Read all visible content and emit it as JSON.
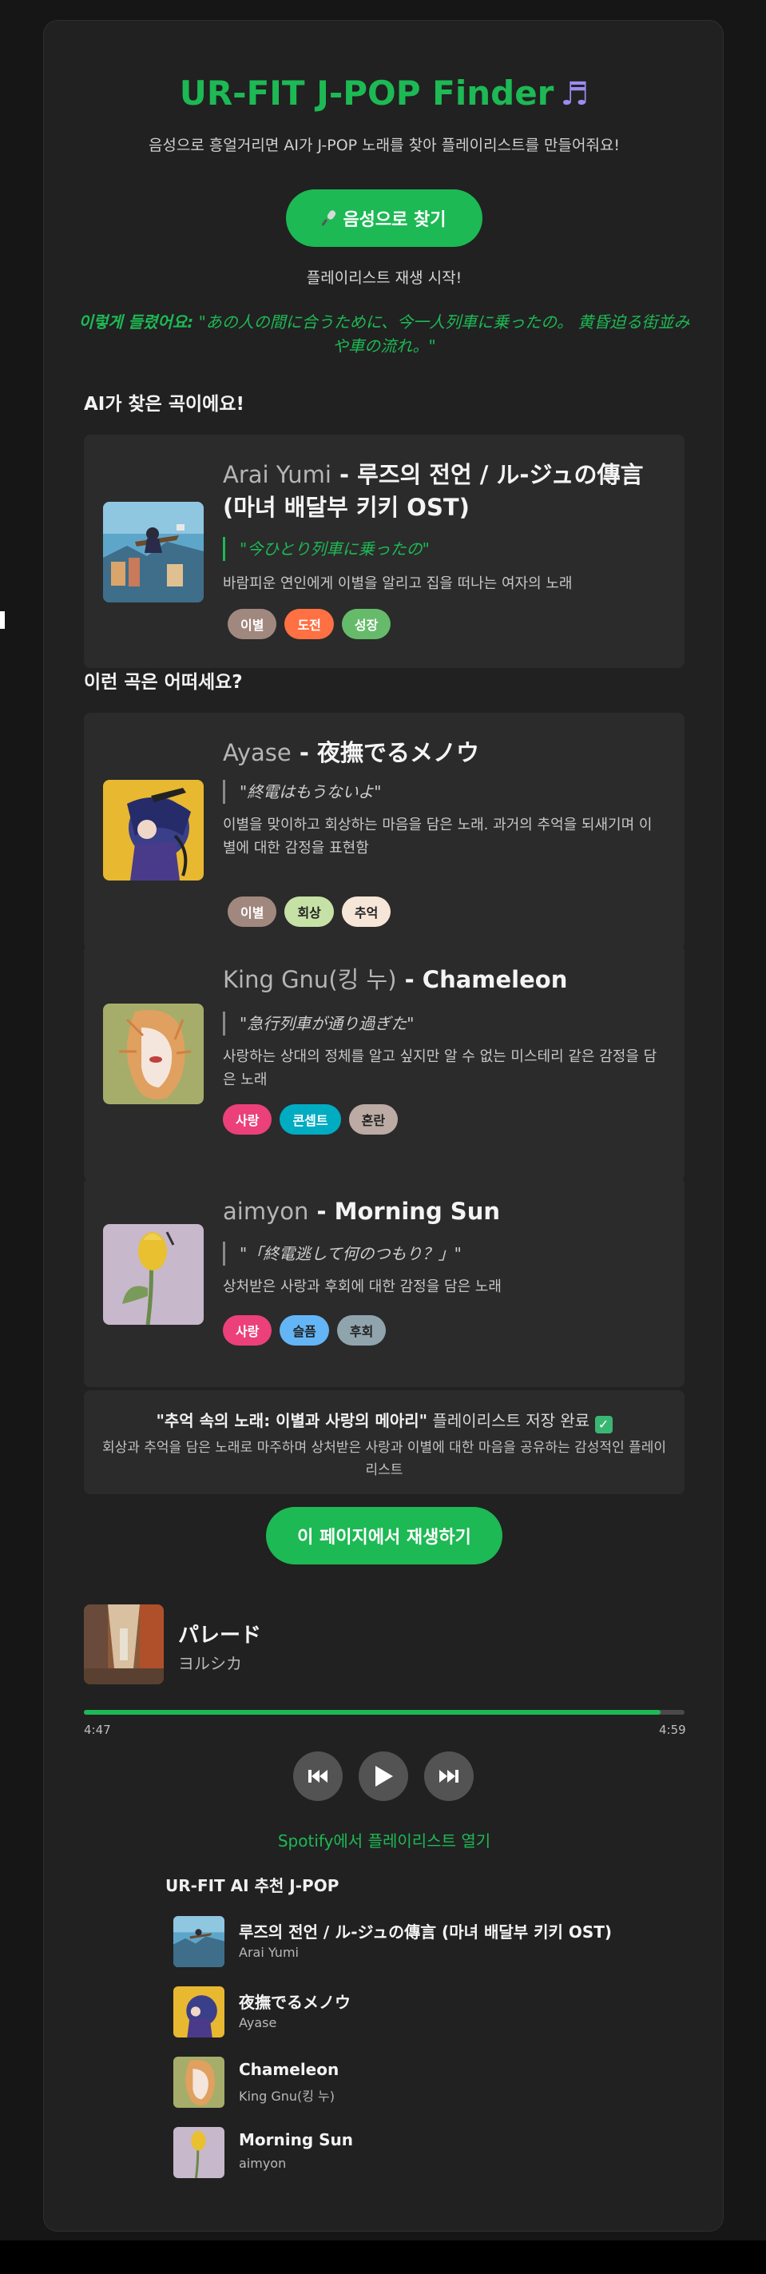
{
  "header": {
    "title": "UR-FIT J-POP Finder",
    "title_icon": "music-note-icon",
    "subtitle": "음성으로 흥얼거리면 AI가 J-POP 노래를 찾아 플레이리스트를 만들어줘요!",
    "voice_button_label": "음성으로 찾기",
    "voice_button_icon": "microphone-icon",
    "status_text": "플레이리스트 재생 시작!",
    "heard_label": "이렇게 들렸어요:",
    "heard_text": "\"あの人の間に合うために、今一人列車に乗ったの。 黄昏迫る街並みや車の流れ。\""
  },
  "found": {
    "section_title": "AI가 찾은 곡이에요!",
    "song": {
      "artist": "Arai Yumi",
      "separator": "-",
      "title": "루즈의 전언 / ル-ジュの傳言 (마녀 배달부 키키 OST)",
      "lyric": "\"今ひとり列車に乗ったの\"",
      "description": "바람피운 연인에게 이별을 알리고 집을 떠나는 여자의 노래",
      "tags": [
        {
          "label": "이별",
          "color": "#a1887f"
        },
        {
          "label": "도전",
          "color": "#ff7043"
        },
        {
          "label": "성장",
          "color": "#66bb6a"
        }
      ]
    }
  },
  "recommend": {
    "section_title": "이런 곡은 어떠세요?",
    "songs": [
      {
        "artist": "Ayase",
        "separator": "-",
        "title": "夜撫でるメノウ",
        "lyric": "\"終電はもうないよ\"",
        "description": "이별을 맞이하고 회상하는 마음을 담은 노래. 과거의 추억을 되새기며 이별에 대한 감정을 표현함",
        "tags": [
          {
            "label": "이별",
            "color": "#a1887f",
            "text_color": "#ffffff"
          },
          {
            "label": "회상",
            "color": "#c5e1a5",
            "text_color": "#222222"
          },
          {
            "label": "추억",
            "color": "#f5e6d8",
            "text_color": "#222222"
          }
        ]
      },
      {
        "artist": "King Gnu(킹 누)",
        "separator": "-",
        "title": "Chameleon",
        "lyric": "\"急行列車が通り過ぎた\"",
        "description": "사랑하는 상대의 정체를 알고 싶지만 알 수 없는 미스테리 같은 감정을 담은 노래",
        "tags": [
          {
            "label": "사랑",
            "color": "#ec407a",
            "text_color": "#ffffff"
          },
          {
            "label": "콘셉트",
            "color": "#00acc1",
            "text_color": "#ffffff"
          },
          {
            "label": "혼란",
            "color": "#bcaaa4",
            "text_color": "#222222"
          }
        ]
      },
      {
        "artist": "aimyon",
        "separator": "-",
        "title": "Morning Sun",
        "lyric": "\"「終電逃して何のつもり？」\"",
        "description": "상처받은 사랑과 후회에 대한 감정을 담은 노래",
        "tags": [
          {
            "label": "사랑",
            "color": "#ec407a",
            "text_color": "#ffffff"
          },
          {
            "label": "슬픔",
            "color": "#64b5f6",
            "text_color": "#222222"
          },
          {
            "label": "후회",
            "color": "#90a4ae",
            "text_color": "#222222"
          }
        ]
      }
    ]
  },
  "saved": {
    "playlist_name": "\"추억 속의 노래: 이별과 사랑의 메아리\"",
    "saved_text": "플레이리스트 저장 완료",
    "check_icon": "check-box-icon",
    "description": "회상과 추억을 담은 노래로 마주하며 상처받은 사랑과 이별에 대한 마음을 공유하는 감성적인 플레이리스트"
  },
  "player": {
    "play_here_label": "이 페이지에서 재생하기",
    "now_playing_title": "パレード",
    "now_playing_artist": "ヨルシカ",
    "elapsed": "4:47",
    "duration": "4:59",
    "progress": 0.96,
    "controls": [
      "previous-icon",
      "play-icon",
      "next-icon"
    ],
    "spotify_link": "Spotify에서 플레이리스트 열기"
  },
  "playlist": {
    "title": "UR-FIT AI 추천 J-POP",
    "items": [
      {
        "name": "루즈의 전언 / ル-ジュの傳言 (마녀 배달부 키키 OST)",
        "artist": "Arai Yumi"
      },
      {
        "name": "夜撫でるメノウ",
        "artist": "Ayase"
      },
      {
        "name": "Chameleon",
        "artist": "King Gnu(킹 누)"
      },
      {
        "name": "Morning Sun",
        "artist": "aimyon"
      }
    ]
  },
  "colors": {
    "accent": "#1db954",
    "card_bg": "#212121",
    "song_bg": "#2b2b2b",
    "page_bg": "#161616"
  }
}
